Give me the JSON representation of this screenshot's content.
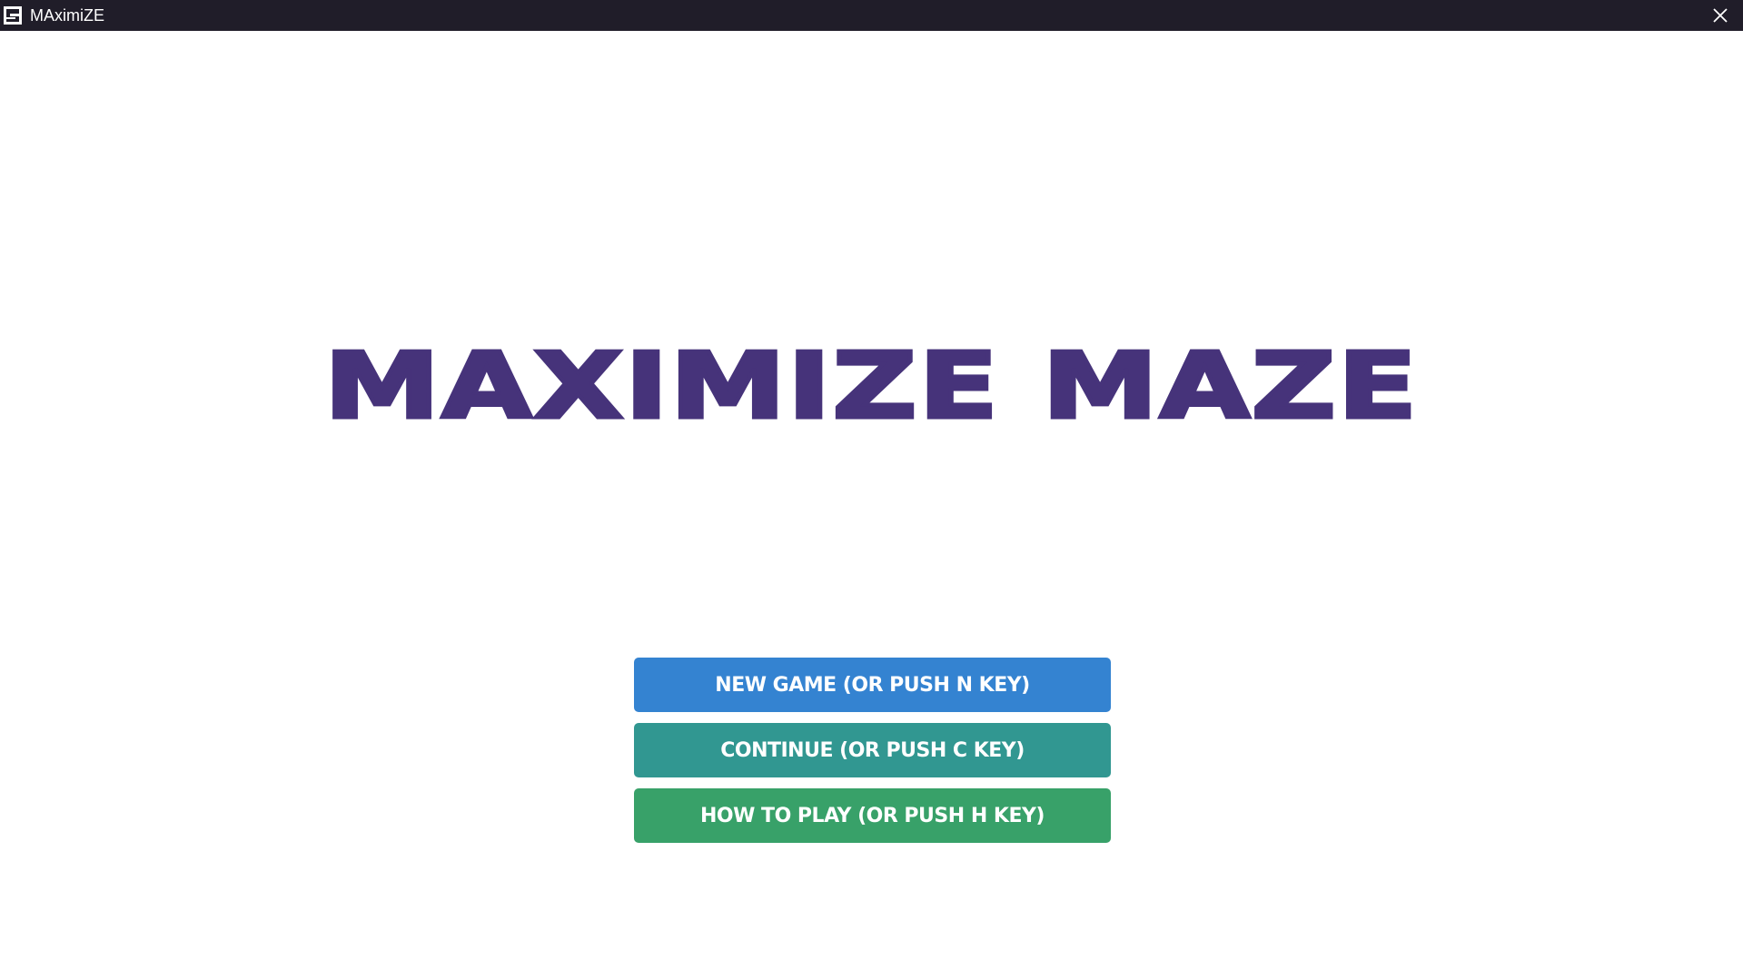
{
  "window": {
    "title": "MAximiZE",
    "icon": "maze-app-icon",
    "close_icon": "close-icon"
  },
  "game": {
    "title": "MAXIMIZE MAZE",
    "title_color": "#46337a"
  },
  "menu": {
    "items": [
      {
        "label": "NEW GAME (OR PUSH N KEY)",
        "color": "#3483d1"
      },
      {
        "label": "CONTINUE (OR PUSH C KEY)",
        "color": "#319791"
      },
      {
        "label": "HOW TO PLAY (OR PUSH H KEY)",
        "color": "#38a169"
      }
    ]
  }
}
